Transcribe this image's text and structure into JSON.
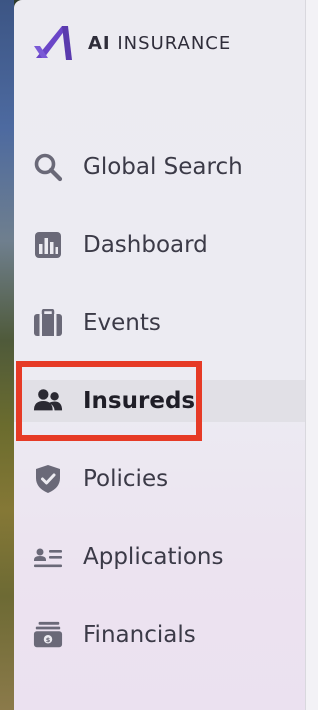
{
  "app": {
    "logo_text_bold": "AI",
    "logo_text_rest": "INSURANCE",
    "brand_color": "#6a45c8"
  },
  "nav": {
    "items": [
      {
        "id": "global-search",
        "label": "Global Search",
        "icon": "search-icon"
      },
      {
        "id": "dashboard",
        "label": "Dashboard",
        "icon": "bar-chart-icon"
      },
      {
        "id": "events",
        "label": "Events",
        "icon": "briefcase-icon"
      },
      {
        "id": "insureds",
        "label": "Insureds",
        "icon": "users-icon",
        "active": true
      },
      {
        "id": "policies",
        "label": "Policies",
        "icon": "shield-icon"
      },
      {
        "id": "applications",
        "label": "Applications",
        "icon": "id-card-icon"
      },
      {
        "id": "financials",
        "label": "Financials",
        "icon": "money-icon"
      }
    ]
  },
  "highlight_color": "#e63a26"
}
